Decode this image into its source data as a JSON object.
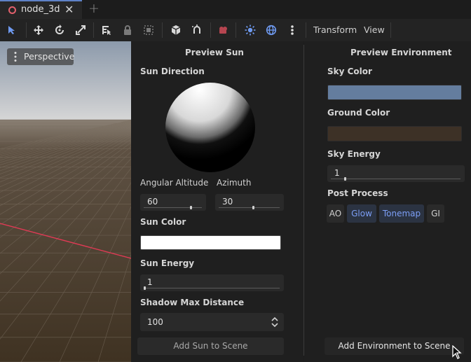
{
  "tab": {
    "label": "node_3d",
    "close": "✕",
    "add": "+"
  },
  "toolbar": {
    "transform_menu": "Transform",
    "view_menu": "View"
  },
  "viewport": {
    "perspective_label": "Perspective"
  },
  "sun": {
    "title": "Preview Sun",
    "direction_label": "Sun Direction",
    "altitude_label": "Angular Altitude",
    "azimuth_label": "Azimuth",
    "altitude_value": "60",
    "azimuth_value": "30",
    "color_label": "Sun Color",
    "color": "#ffffff",
    "energy_label": "Sun Energy",
    "energy_value": "1",
    "shadow_label": "Shadow Max Distance",
    "shadow_value": "100",
    "add_button": "Add Sun to Scene"
  },
  "environment": {
    "title": "Preview Environment",
    "sky_color_label": "Sky Color",
    "sky_color": "#647d9e",
    "ground_color_label": "Ground Color",
    "ground_color": "#3d3126",
    "sky_energy_label": "Sky Energy",
    "sky_energy_value": "1",
    "post_process_label": "Post Process",
    "post_process": [
      {
        "label": "AO",
        "active": false
      },
      {
        "label": "Glow",
        "active": true
      },
      {
        "label": "Tonemap",
        "active": true
      },
      {
        "label": "GI",
        "active": false
      }
    ],
    "add_button": "Add Environment to Scene"
  }
}
